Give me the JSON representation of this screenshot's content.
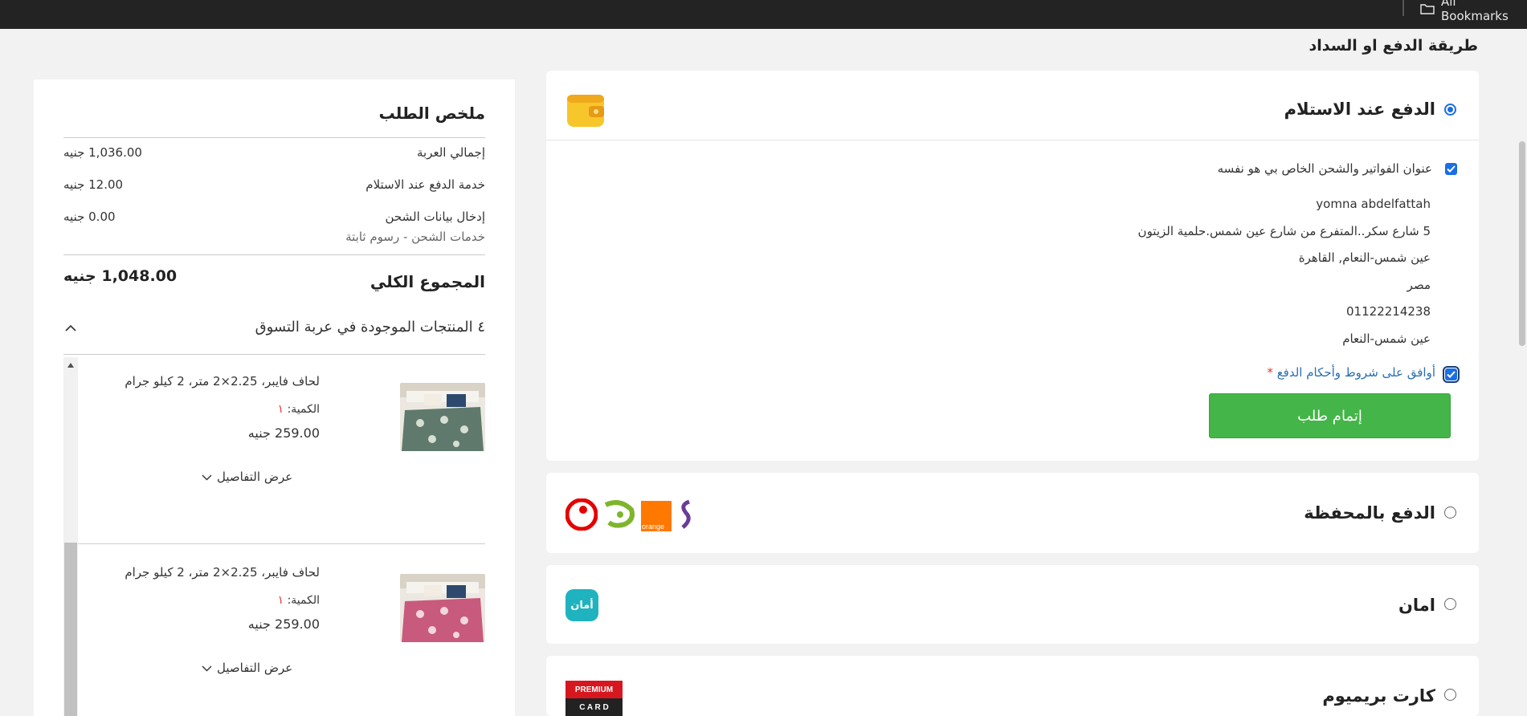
{
  "browser": {
    "bookmarks_label": "All Bookmarks"
  },
  "page": {
    "title": "طريقة الدفع او السداد"
  },
  "payment_methods": {
    "cod": {
      "title": "الدفع عند الاستلام",
      "selected": true,
      "same_address_label": "عنوان الفواتير والشحن الخاص بي هو نفسه",
      "address": {
        "name": "yomna abdelfattah",
        "street": "5 شارع سكر..المتفرع من شارع عين شمس.حلمية الزيتون",
        "city": "عين شمس-النعام, القاهرة",
        "country": "مصر",
        "phone": "01122214238",
        "area": "عين شمس-النعام"
      },
      "terms_label": "أوافق على شروط وأحكام الدفع",
      "terms_required_mark": "*",
      "place_order_label": "إتمام طلب"
    },
    "wallet": {
      "title": "الدفع بالمحفظة",
      "selected": false,
      "logo_text": "orange"
    },
    "aman": {
      "title": "امان",
      "selected": false,
      "logo_text": "أمان"
    },
    "premium": {
      "title": "كارت بريميوم",
      "selected": false,
      "logo_top": "PREMIUM",
      "logo_bottom": "C A R D"
    }
  },
  "summary": {
    "title": "ملخص الطلب",
    "rows": [
      {
        "label": "إجمالي العربة",
        "value": "1,036.00 جنيه"
      },
      {
        "label": "خدمة الدفع عند الاستلام",
        "value": "12.00 جنيه"
      },
      {
        "label": "إدخال بيانات الشحن",
        "value": "0.00 جنيه",
        "sub": "خدمات الشحن - رسوم ثابتة"
      }
    ],
    "total_label": "المجموع الكلي",
    "total_value": "1,048.00 جنيه",
    "items_toggle_label": "٤ المنتجات الموجودة في عربة التسوق",
    "items": [
      {
        "name": "لحاف فايبر، 2.25×2 متر، 2 كيلو جرام",
        "qty_label": "الكمية:",
        "qty": "١",
        "price": "259.00 جنيه",
        "details_label": "عرض التفاصيل",
        "color": "#5f7a6c"
      },
      {
        "name": "لحاف فايبر، 2.25×2 متر، 2 كيلو جرام",
        "qty_label": "الكمية:",
        "qty": "١",
        "price": "259.00 جنيه",
        "details_label": "عرض التفاصيل",
        "color": "#c85a7d"
      }
    ]
  }
}
